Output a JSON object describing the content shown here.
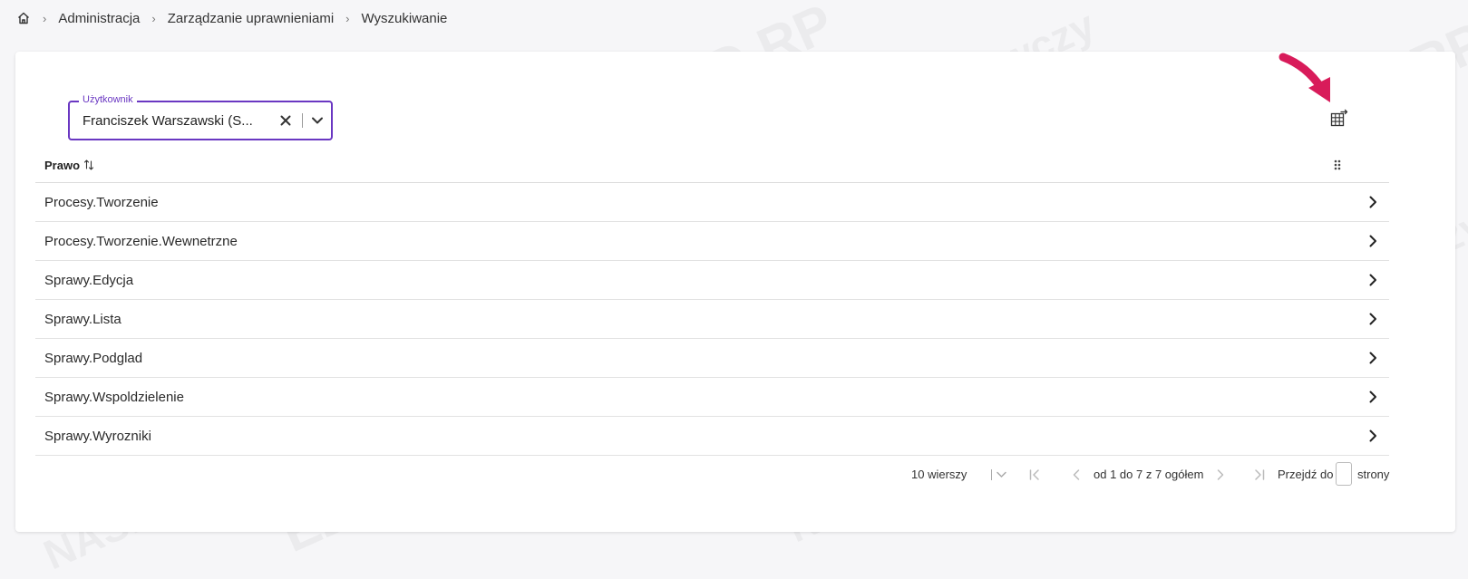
{
  "breadcrumb": {
    "home_icon": "home-icon",
    "items": [
      "Administracja",
      "Zarządzanie uprawnieniami",
      "Wyszukiwanie"
    ]
  },
  "filter": {
    "label": "Użytkownik",
    "value": "Franciszek Warszawski (S...",
    "accent_color": "#6a37c2"
  },
  "toolbar": {
    "export_icon": "table-export-icon",
    "annotation_arrow_color": "#d81b5a"
  },
  "table": {
    "column_header": "Prawo",
    "sort_icon": "sort-arrows-icon",
    "settings_icon": "drag-grip-icon",
    "rows": [
      "Procesy.Tworzenie",
      "Procesy.Tworzenie.Wewnetrzne",
      "Sprawy.Edycja",
      "Sprawy.Lista",
      "Sprawy.Podglad",
      "Sprawy.Wspoldzielenie",
      "Sprawy.Wyrozniki"
    ]
  },
  "pagination": {
    "rows_per_page": "10 wierszy",
    "range": "od 1 do 7 z 7 ogółem",
    "goto_label": "Przejdź do",
    "pages_label": "strony",
    "goto_value": ""
  },
  "watermark": {
    "lines": [
      "NASK - Państwowy Instytut Badawczy",
      "EZD RP"
    ]
  }
}
